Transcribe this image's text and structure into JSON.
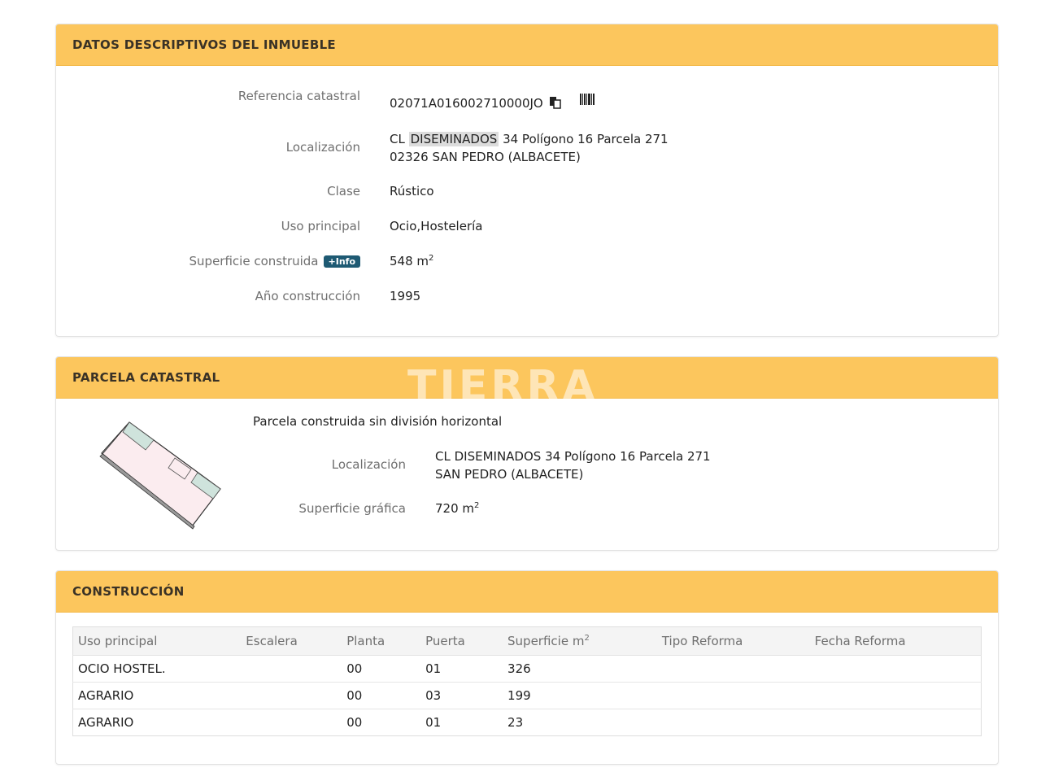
{
  "section1": {
    "title": "DATOS DESCRIPTIVOS DEL INMUEBLE",
    "rows": {
      "referencia": {
        "label": "Referencia catastral",
        "value": "02071A016002710000JO"
      },
      "localizacion": {
        "label": "Localización",
        "line1_prefix": "CL ",
        "line1_highlight": "DISEMINADOS",
        "line1_suffix": " 34 Polígono 16 Parcela 271",
        "line2": "02326 SAN PEDRO (ALBACETE)"
      },
      "clase": {
        "label": "Clase",
        "value": "Rústico"
      },
      "uso": {
        "label": "Uso principal",
        "value": "Ocio,Hostelería"
      },
      "superficie": {
        "label": "Superficie construida",
        "badge": "+Info",
        "value": "548 m",
        "unit_sup": "2"
      },
      "anio": {
        "label": "Año construcción",
        "value": "1995"
      }
    }
  },
  "section2": {
    "title": "PARCELA CATASTRAL",
    "watermark": "TIERRA",
    "subtitle": "Parcela construida sin división horizontal",
    "localizacion": {
      "label": "Localización",
      "line1": "CL DISEMINADOS 34 Polígono 16 Parcela 271",
      "line2": "SAN PEDRO (ALBACETE)"
    },
    "superficie": {
      "label": "Superficie gráfica",
      "value": "720 m",
      "unit_sup": "2"
    }
  },
  "section3": {
    "title": "CONSTRUCCIÓN",
    "headers": [
      "Uso principal",
      "Escalera",
      "Planta",
      "Puerta",
      "Superficie m",
      "Tipo Reforma",
      "Fecha Reforma"
    ],
    "header_sup": "2",
    "rows": [
      [
        "OCIO HOSTEL.",
        "",
        "00",
        "01",
        "326",
        "",
        ""
      ],
      [
        "AGRARIO",
        "",
        "00",
        "03",
        "199",
        "",
        ""
      ],
      [
        "AGRARIO",
        "",
        "00",
        "01",
        "23",
        "",
        ""
      ]
    ]
  },
  "colors": {
    "header_bg": "#fcc65d",
    "badge_bg": "#1e5a73"
  },
  "icons": [
    "copy-icon",
    "barcode-icon",
    "parcel-map-icon"
  ]
}
